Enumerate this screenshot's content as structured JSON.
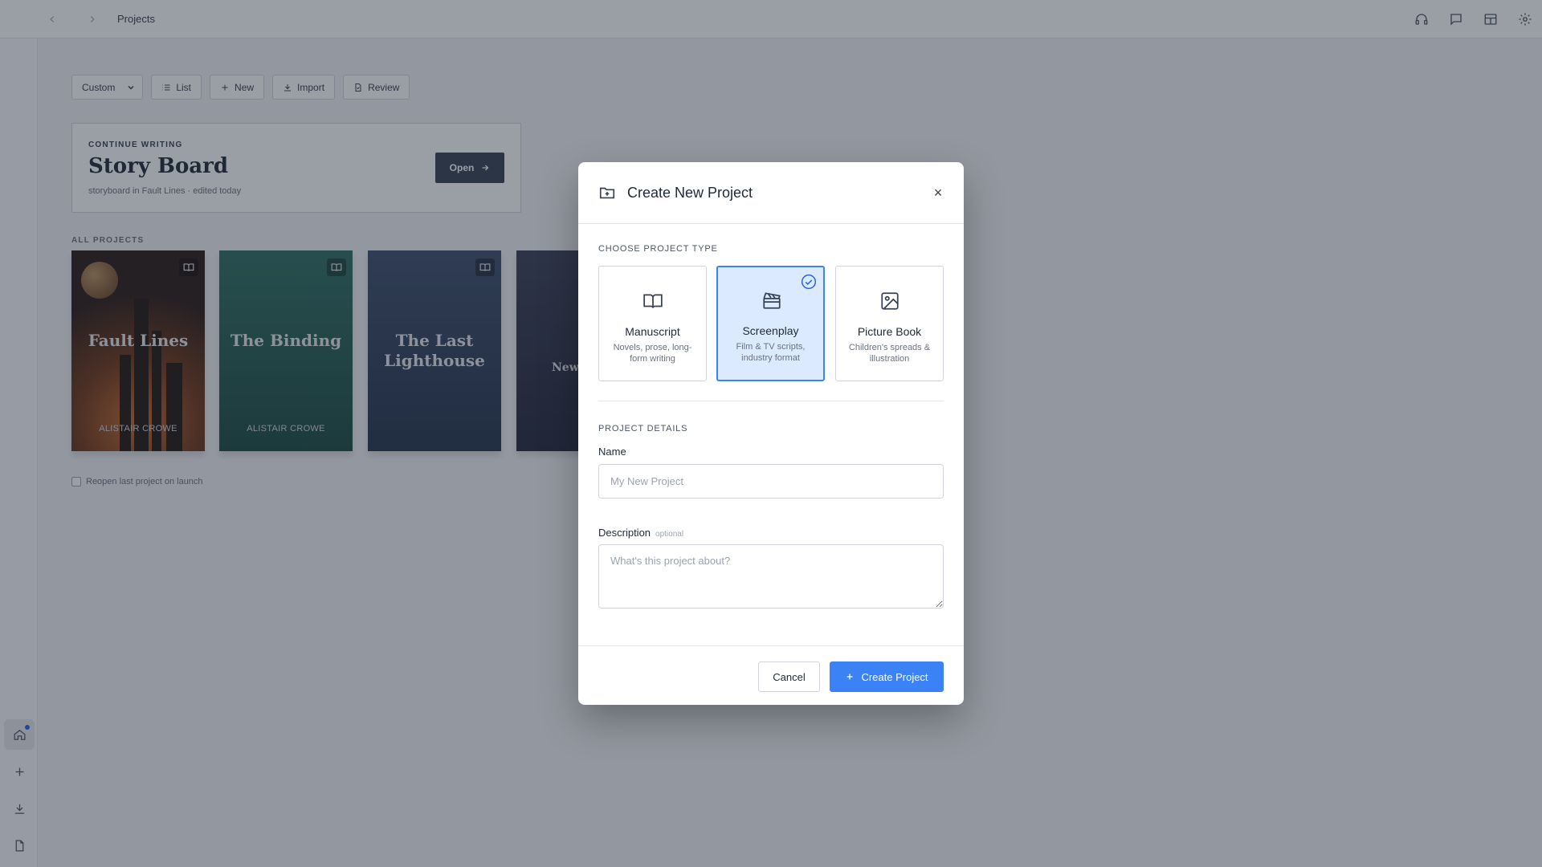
{
  "topbar": {
    "back_icon": "arrow-left-icon",
    "forward_icon": "arrow-right-icon",
    "title": "Projects",
    "right_icons": [
      "headphones-icon",
      "chat-icon",
      "layout-icon",
      "gear-icon"
    ]
  },
  "rail": {
    "items": [
      "home-icon",
      "plus-icon",
      "download-icon",
      "document-icon"
    ],
    "active": "home-icon"
  },
  "toolbar": {
    "view_select": "Custom",
    "list_label": "List",
    "new_label": "New",
    "import_label": "Import",
    "review_label": "Review"
  },
  "continue": {
    "eyebrow": "CONTINUE WRITING",
    "title": "Story Board",
    "meta": "storyboard in Fault Lines · edited today",
    "open_label": "Open"
  },
  "projects": {
    "section_label": "ALL PROJECTS",
    "books": [
      {
        "title": "Fault Lines",
        "author": "ALISTAIR CROWE"
      },
      {
        "title": "The Binding",
        "author": "ALISTAIR CROWE"
      },
      {
        "title": "The Last Lighthouse",
        "author": ""
      },
      {
        "title": "New",
        "author": ""
      }
    ],
    "reopen_label": "Reopen last project on launch"
  },
  "modal": {
    "title": "Create New Project",
    "close_glyph": "×",
    "type_section": "CHOOSE PROJECT TYPE",
    "types": [
      {
        "name": "Manuscript",
        "desc": "Novels, prose, long-form writing",
        "icon": "book-icon",
        "selected": false
      },
      {
        "name": "Screenplay",
        "desc": "Film & TV scripts, industry format",
        "icon": "clapperboard-icon",
        "selected": true
      },
      {
        "name": "Picture Book",
        "desc": "Children's spreads & illustration",
        "icon": "image-icon",
        "selected": false
      }
    ],
    "details_section": "PROJECT DETAILS",
    "name_label": "Name",
    "name_placeholder": "My New Project",
    "description_label": "Description",
    "description_optional": "optional",
    "description_placeholder": "What's this project about?",
    "cancel_label": "Cancel",
    "create_label": "Create Project"
  },
  "colors": {
    "accent": "#3b82f6",
    "accent_light": "#dbeafe",
    "dark_button": "#374151"
  }
}
